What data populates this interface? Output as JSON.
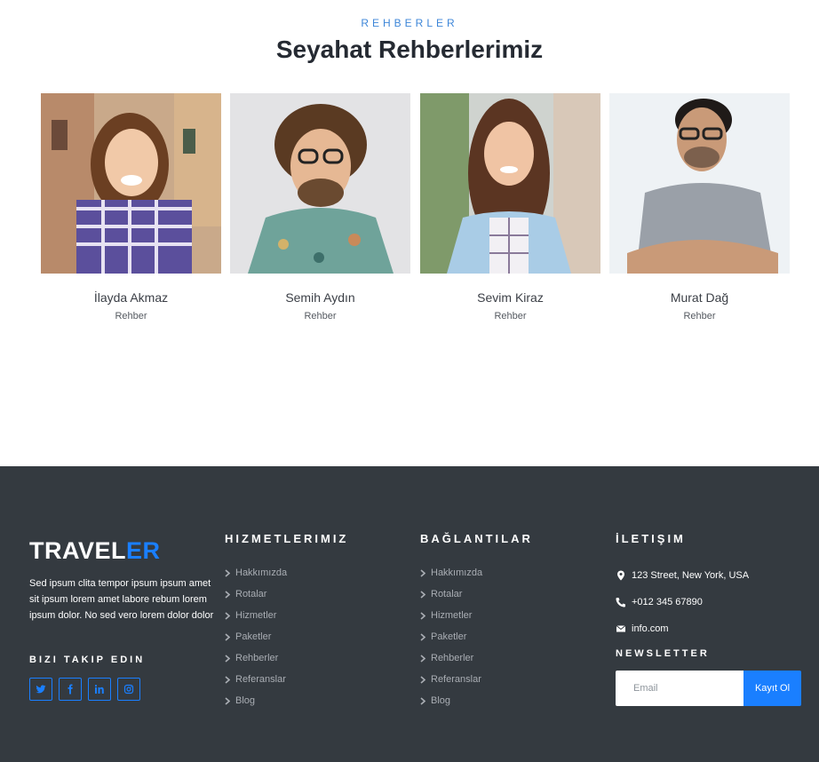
{
  "guides": {
    "kicker": "REHBERLER",
    "title": "Seyahat Rehberlerimiz",
    "items": [
      {
        "name": "İlayda Akmaz",
        "role": "Rehber"
      },
      {
        "name": "Semih Aydın",
        "role": "Rehber"
      },
      {
        "name": "Sevim Kiraz",
        "role": "Rehber"
      },
      {
        "name": "Murat Dağ",
        "role": "Rehber"
      }
    ]
  },
  "footer": {
    "brand_main": "TRAVEL",
    "brand_accent": "ER",
    "about": "Sed ipsum clita tempor ipsum ipsum amet sit ipsum lorem amet labore rebum lorem ipsum dolor. No sed vero lorem dolor dolor",
    "follow_title": "BIZI TAKIP EDIN",
    "socials": [
      "twitter-icon",
      "facebook-icon",
      "linkedin-icon",
      "instagram-icon"
    ],
    "services": {
      "title": "HIZMETLERIMIZ",
      "links": [
        "Hakkımızda",
        "Rotalar",
        "Hizmetler",
        "Paketler",
        "Rehberler",
        "Referanslar",
        "Blog"
      ]
    },
    "links_col": {
      "title": "BAĞLANTILAR",
      "links": [
        "Hakkımızda",
        "Rotalar",
        "Hizmetler",
        "Paketler",
        "Rehberler",
        "Referanslar",
        "Blog"
      ]
    },
    "contact": {
      "title": "İLETIŞIM",
      "address": "123 Street, New York, USA",
      "phone": "+012 345 67890",
      "email": "info.com"
    },
    "newsletter": {
      "title": "NEWSLETTER",
      "placeholder": "Email",
      "button": "Kayıt Ol"
    }
  },
  "colors": {
    "accent": "#1a7fff",
    "footer_bg": "#343a40",
    "kicker": "#3d86d8"
  }
}
